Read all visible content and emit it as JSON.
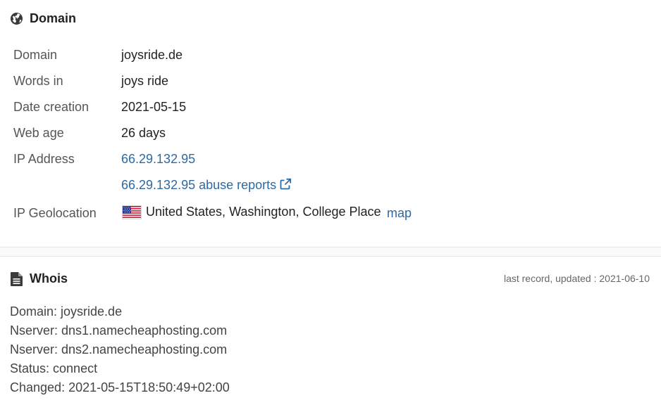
{
  "domain_section": {
    "title": "Domain",
    "icon": "globe-icon",
    "rows": {
      "domain": {
        "label": "Domain",
        "value": "joysride.de"
      },
      "words": {
        "label": "Words in",
        "value": "joys ride"
      },
      "created": {
        "label": "Date creation",
        "value": "2021-05-15"
      },
      "age": {
        "label": "Web age",
        "value": "26 days"
      },
      "ip": {
        "label": "IP Address",
        "value": "66.29.132.95"
      },
      "abuse": {
        "value": "66.29.132.95 abuse reports",
        "icon": "external-link-icon"
      },
      "geo": {
        "label": "IP Geolocation",
        "flag": "us-flag-icon",
        "value": "United States, Washington, College Place",
        "map_link": "map"
      }
    }
  },
  "whois_section": {
    "title": "Whois",
    "icon": "document-icon",
    "updated": "last record, updated : 2021-06-10",
    "lines": [
      "Domain: joysride.de",
      "Nserver: dns1.namecheaphosting.com",
      "Nserver: dns2.namecheaphosting.com",
      "Status: connect",
      "Changed: 2021-05-15T18:50:49+02:00"
    ]
  },
  "colors": {
    "link": "#2d6aa3",
    "label": "#555555",
    "text": "#222222",
    "muted": "#666666"
  }
}
